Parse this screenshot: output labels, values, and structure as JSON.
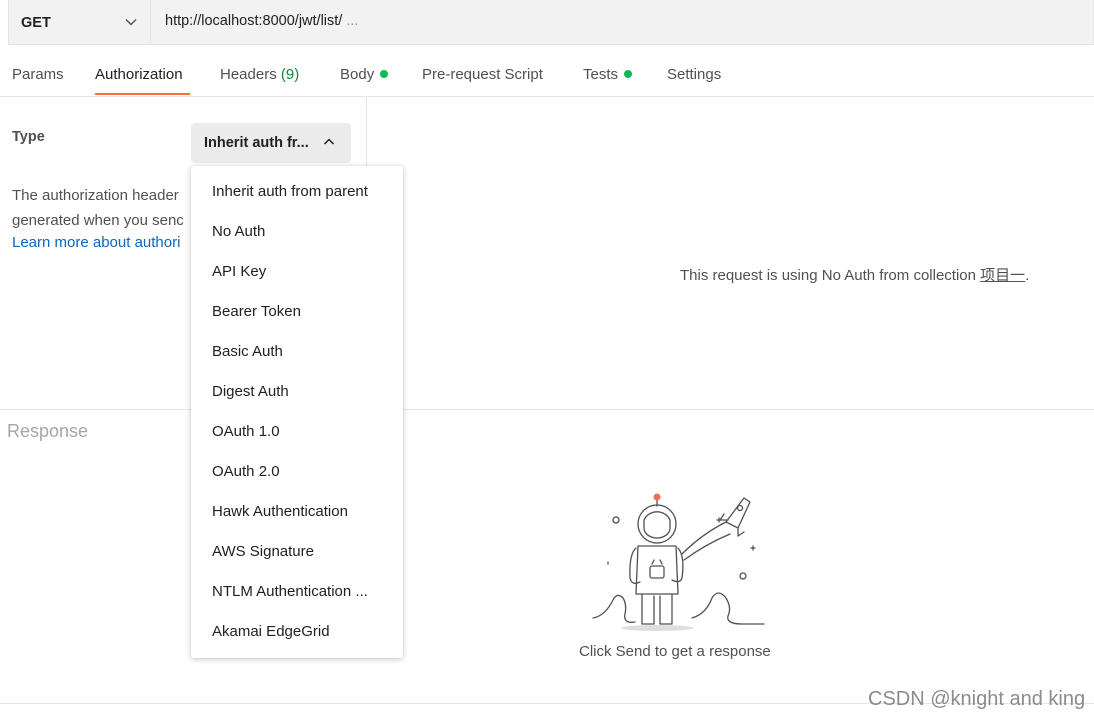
{
  "request": {
    "method": "GET",
    "url": "http://localhost:8000/jwt/list/",
    "url_ellipsis": "..."
  },
  "tabs": {
    "params": "Params",
    "authorization": "Authorization",
    "headers": "Headers",
    "headers_count": "(9)",
    "body": "Body",
    "pre_request": "Pre-request Script",
    "tests": "Tests",
    "settings": "Settings",
    "active": "Authorization"
  },
  "auth": {
    "type_label": "Type",
    "selected": "Inherit auth fr...",
    "desc_line1": "The authorization header",
    "desc_line2": "generated when you senc",
    "learn_more": "Learn more about authori",
    "no_auth_msg": "This request is using No Auth from collection",
    "collection_name": "项目一",
    "period": ".",
    "options": [
      "Inherit auth from parent",
      "No Auth",
      "API Key",
      "Bearer Token",
      "Basic Auth",
      "Digest Auth",
      "OAuth 1.0",
      "OAuth 2.0",
      "Hawk Authentication",
      "AWS Signature",
      "NTLM Authentication ...",
      "Akamai EdgeGrid"
    ]
  },
  "response": {
    "label": "Response",
    "empty_message": "Click Send to get a response",
    "illustration": "astronaut-rocket-illustration"
  },
  "watermark": "CSDN @knight and king",
  "colors": {
    "accent": "#ff6c37",
    "status_dot": "#0cbb52",
    "link": "#0b66c2",
    "astronaut_antenna": "#f26b5b"
  }
}
